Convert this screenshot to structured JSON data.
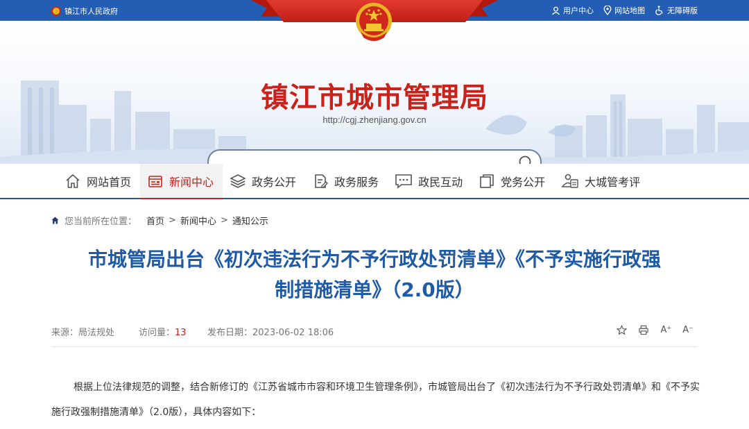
{
  "topbar": {
    "gov_name": "镇江市人民政府",
    "user_center": "用户中心",
    "sitemap": "网站地图",
    "accessible": "无障碍版"
  },
  "banner": {
    "title": "镇江市城市管理局",
    "url": "http://cgj.zhenjiang.gov.cn",
    "search_placeholder": ""
  },
  "nav": {
    "items": [
      {
        "label": "网站首页",
        "icon": "home-icon"
      },
      {
        "label": "新闻中心",
        "icon": "news-icon"
      },
      {
        "label": "政务公开",
        "icon": "layers-icon"
      },
      {
        "label": "政务服务",
        "icon": "document-edit-icon"
      },
      {
        "label": "政民互动",
        "icon": "chat-icon"
      },
      {
        "label": "党务公开",
        "icon": "copy-icon"
      },
      {
        "label": "大城管考评",
        "icon": "evaluation-icon"
      }
    ],
    "active_index": 1
  },
  "breadcrumb": {
    "lead": "您当前所在位置：",
    "items": [
      "首页",
      "新闻中心",
      "通知公示"
    ],
    "sep": ">"
  },
  "article": {
    "title_line1": "市城管局出台《初次违法行为不予行政处罚清单》《不予实施行政强",
    "title_line2": "制措施清单》（2.0版）",
    "source_label": "来源：",
    "source": "局法规处",
    "visits_label": "访问量：",
    "visits": "13",
    "date_label": "发布日期：",
    "date": "2023-06-02 18:06",
    "tools": {
      "font_up": "A⁺",
      "font_down": "A⁻"
    },
    "body_line1": "根据上位法律规范的调整，结合新修订的《江苏省城市市容和环境卫生管理条例》，市城管局出台了《初次违法行为不予行政处罚清",
    "body_line2": "单》和《不予实施行政强制措施清单》（2.0版），具体内容如下："
  },
  "colors": {
    "topbar": "#245db4",
    "brand_red": "#c8221a",
    "title_blue": "#1f5aa6"
  }
}
